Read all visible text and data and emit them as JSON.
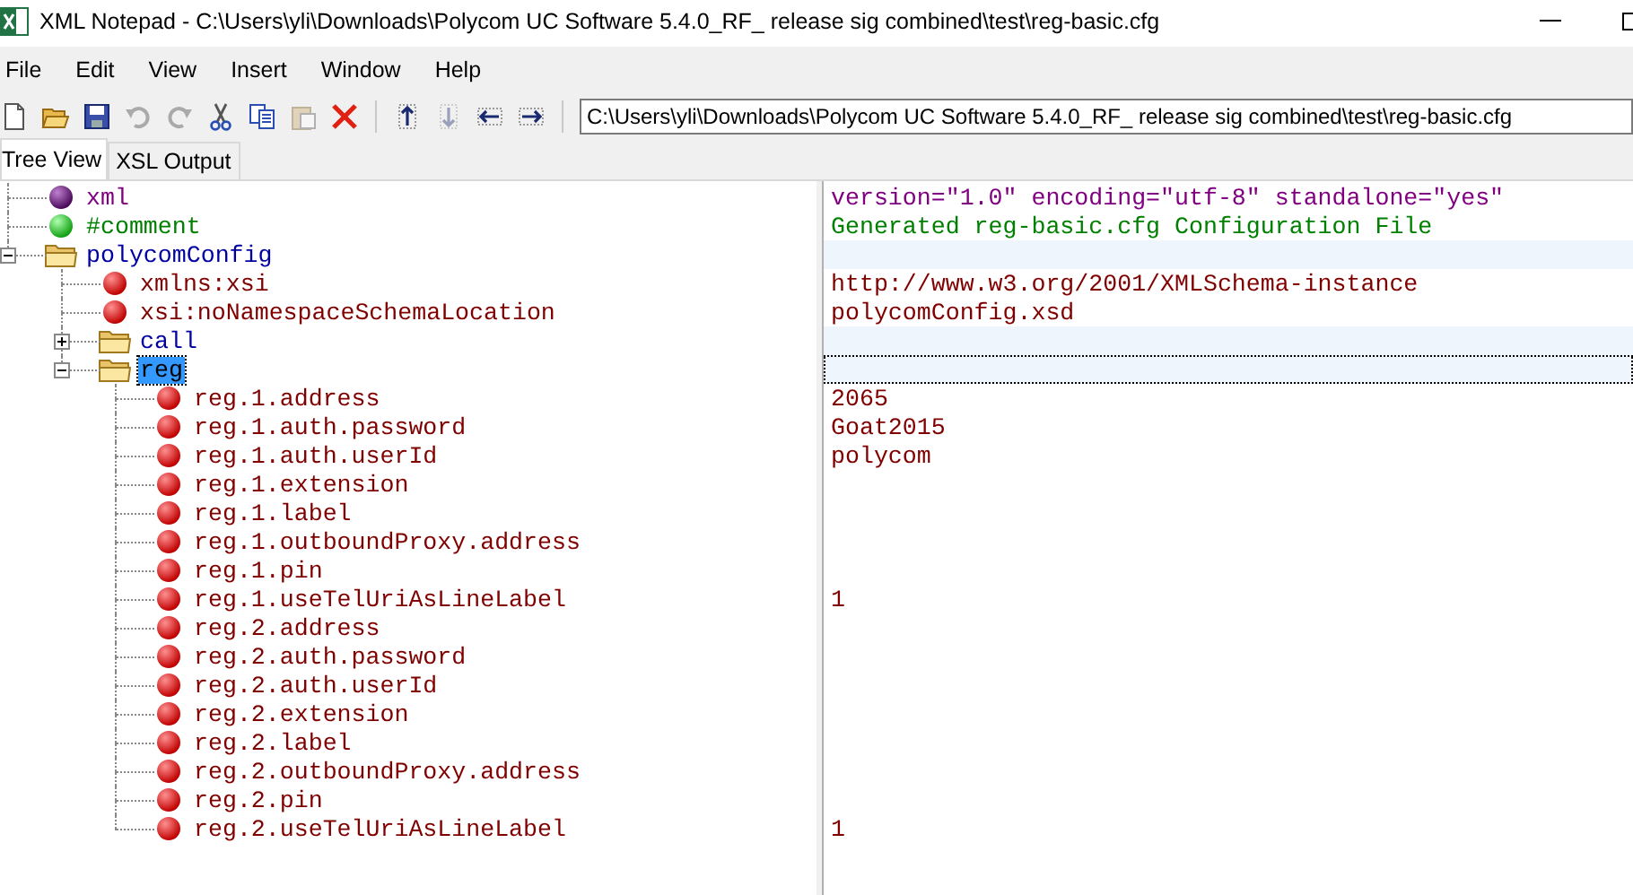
{
  "window": {
    "title": "XML Notepad - C:\\Users\\yli\\Downloads\\Polycom UC Software 5.4.0_RF_ release sig combined\\test\\reg-basic.cfg"
  },
  "menu": [
    "File",
    "Edit",
    "View",
    "Insert",
    "Window",
    "Help"
  ],
  "toolbar": [
    {
      "kind": "new",
      "disabled": false
    },
    {
      "kind": "open",
      "disabled": false
    },
    {
      "kind": "save",
      "disabled": false
    },
    {
      "kind": "undo",
      "disabled": true
    },
    {
      "kind": "redo",
      "disabled": true
    },
    {
      "kind": "cut",
      "disabled": false
    },
    {
      "kind": "copy",
      "disabled": false
    },
    {
      "kind": "paste",
      "disabled": true
    },
    {
      "kind": "delete",
      "disabled": false
    },
    {
      "kind": "nudge-up",
      "disabled": false
    },
    {
      "kind": "nudge-down",
      "disabled": true
    },
    {
      "kind": "nudge-left",
      "disabled": false
    },
    {
      "kind": "nudge-right",
      "disabled": false
    }
  ],
  "location": {
    "value": "C:\\Users\\yli\\Downloads\\Polycom UC Software 5.4.0_RF_ release sig combined\\test\\reg-basic.cfg"
  },
  "tabs": [
    {
      "label": "Tree View",
      "selected": true
    },
    {
      "label": "XSL Output",
      "selected": false
    }
  ],
  "tree": [
    {
      "kind": "declaration",
      "name": "xml",
      "value": "version=\"1.0\" encoding=\"utf-8\" standalone=\"yes\"",
      "selected": false
    },
    {
      "kind": "comment",
      "name": "#comment",
      "value": "Generated reg-basic.cfg Configuration File",
      "selected": false
    },
    {
      "kind": "element",
      "name": "polycomConfig",
      "expanded": true,
      "selected": false,
      "children": [
        {
          "kind": "attribute",
          "name": "xmlns:xsi",
          "value": "http://www.w3.org/2001/XMLSchema-instance",
          "selected": false
        },
        {
          "kind": "attribute",
          "name": "xsi:noNamespaceSchemaLocation",
          "value": "polycomConfig.xsd",
          "selected": false
        },
        {
          "kind": "element",
          "name": "call",
          "expanded": false,
          "selected": false
        },
        {
          "kind": "element",
          "name": "reg",
          "expanded": true,
          "selected": true,
          "children": [
            {
              "kind": "attribute",
              "name": "reg.1.address",
              "value": "2065",
              "selected": false
            },
            {
              "kind": "attribute",
              "name": "reg.1.auth.password",
              "value": "Goat2015",
              "selected": false
            },
            {
              "kind": "attribute",
              "name": "reg.1.auth.userId",
              "value": "polycom",
              "selected": false
            },
            {
              "kind": "attribute",
              "name": "reg.1.extension",
              "selected": false
            },
            {
              "kind": "attribute",
              "name": "reg.1.label",
              "selected": false
            },
            {
              "kind": "attribute",
              "name": "reg.1.outboundProxy.address",
              "selected": false
            },
            {
              "kind": "attribute",
              "name": "reg.1.pin",
              "selected": false
            },
            {
              "kind": "attribute",
              "name": "reg.1.useTelUriAsLineLabel",
              "value": "1",
              "selected": false
            },
            {
              "kind": "attribute",
              "name": "reg.2.address",
              "selected": false
            },
            {
              "kind": "attribute",
              "name": "reg.2.auth.password",
              "selected": false
            },
            {
              "kind": "attribute",
              "name": "reg.2.auth.userId",
              "selected": false
            },
            {
              "kind": "attribute",
              "name": "reg.2.extension",
              "selected": false
            },
            {
              "kind": "attribute",
              "name": "reg.2.label",
              "selected": false
            },
            {
              "kind": "attribute",
              "name": "reg.2.outboundProxy.address",
              "selected": false
            },
            {
              "kind": "attribute",
              "name": "reg.2.pin",
              "selected": false
            },
            {
              "kind": "attribute",
              "name": "reg.2.useTelUriAsLineLabel",
              "value": "1",
              "selected": false
            }
          ]
        }
      ]
    }
  ]
}
